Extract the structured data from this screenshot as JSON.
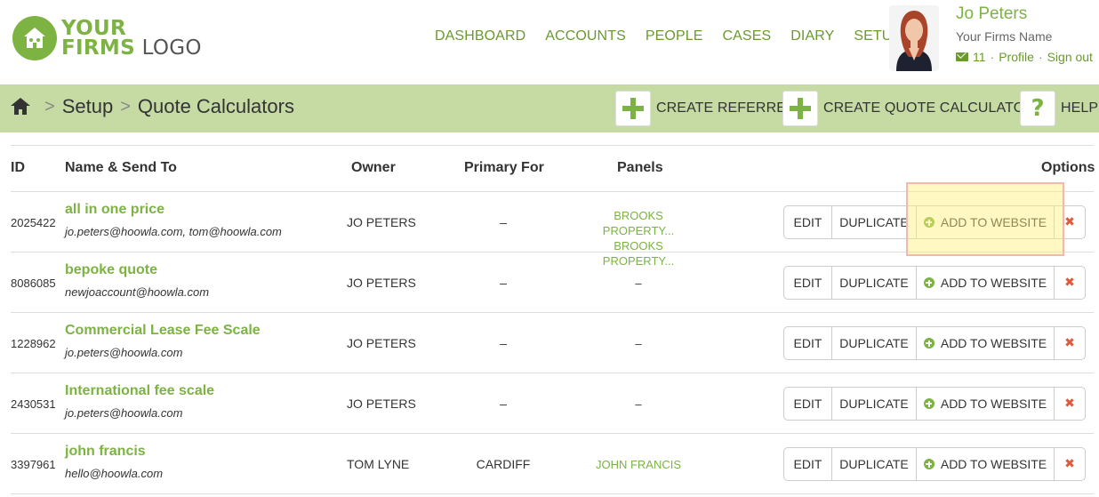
{
  "logo": {
    "line1": "YOUR",
    "line2_firms": "FIRMS",
    "line2_rest": "LOGO"
  },
  "nav": [
    "DASHBOARD",
    "ACCOUNTS",
    "PEOPLE",
    "CASES",
    "DIARY",
    "SETUP"
  ],
  "user": {
    "name": "Jo Peters",
    "firm": "Your Firms Name",
    "messages": "11",
    "profile": "Profile",
    "signout": "Sign out",
    "sep": "·"
  },
  "breadcrumb": {
    "sep": ">",
    "items": [
      "Setup",
      "Quote Calculators"
    ]
  },
  "actions": {
    "create_referrer": "CREATE REFERRER",
    "create_quote_calculator": "CREATE QUOTE CALCULATOR",
    "help": "HELP",
    "help_symbol": "?"
  },
  "table": {
    "headers": {
      "id": "ID",
      "name": "Name & Send To",
      "owner": "Owner",
      "primary": "Primary For",
      "panels": "Panels",
      "options": "Options"
    },
    "buttons": {
      "edit": "EDIT",
      "duplicate": "DUPLICATE",
      "add": "ADD TO WEBSITE",
      "delete": "✖"
    },
    "rows": [
      {
        "id": "2025422",
        "name": "all in one price",
        "email": "jo.peters@hoowla.com, tom@hoowla.com",
        "owner": "JO PETERS",
        "primary": "–",
        "panels": [
          "BROOKS PROPERTY...",
          "BROOKS PROPERTY..."
        ]
      },
      {
        "id": "8086085",
        "name": "bepoke quote",
        "email": "newjoaccount@hoowla.com",
        "owner": "JO PETERS",
        "primary": "–",
        "panels_text": "–"
      },
      {
        "id": "1228962",
        "name": "Commercial Lease Fee Scale",
        "email": "jo.peters@hoowla.com",
        "owner": "JO PETERS",
        "primary": "–",
        "panels_text": "–"
      },
      {
        "id": "2430531",
        "name": "International fee scale",
        "email": "jo.peters@hoowla.com",
        "owner": "JO PETERS",
        "primary": "–",
        "panels_text": "–"
      },
      {
        "id": "3397961",
        "name": "john francis",
        "email": "hello@hoowla.com",
        "owner": "TOM LYNE",
        "primary": "CARDIFF",
        "panels_text": "JOHN FRANCIS"
      }
    ]
  },
  "colors": {
    "brand_green": "#7cb342",
    "bar_bg": "#c5dba3",
    "delete_red": "#e05a3a"
  }
}
